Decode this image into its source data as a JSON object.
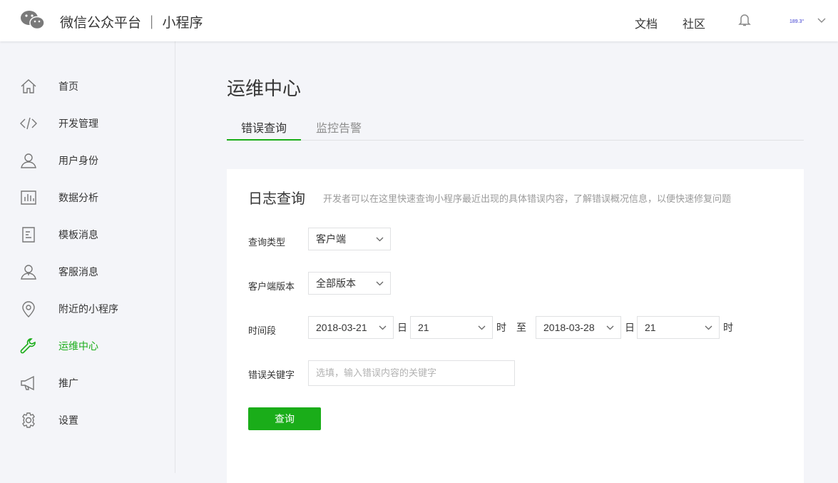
{
  "header": {
    "brand": "微信公众平台 ｜ 小程序",
    "links": [
      "文档",
      "社区"
    ],
    "user": "189.3°"
  },
  "sidebar": {
    "items": [
      {
        "label": "首页",
        "icon": "home-icon"
      },
      {
        "label": "开发管理",
        "icon": "code-icon"
      },
      {
        "label": "用户身份",
        "icon": "user-icon"
      },
      {
        "label": "数据分析",
        "icon": "chart-icon"
      },
      {
        "label": "模板消息",
        "icon": "document-icon"
      },
      {
        "label": "客服消息",
        "icon": "support-icon"
      },
      {
        "label": "附近的小程序",
        "icon": "location-icon"
      },
      {
        "label": "运维中心",
        "icon": "wrench-icon",
        "active": true
      },
      {
        "label": "推广",
        "icon": "megaphone-icon"
      },
      {
        "label": "设置",
        "icon": "gear-icon"
      }
    ]
  },
  "page": {
    "title": "运维中心",
    "tabs": [
      "错误查询",
      "监控告警"
    ]
  },
  "card": {
    "title": "日志查询",
    "desc": "开发者可以在这里快速查询小程序最近出现的具体错误内容，了解错误概况信息，以便快速修复问题",
    "query_type_label": "查询类型",
    "query_type": "客户端",
    "version_label": "客户端版本",
    "version": "全部版本",
    "time_label": "时间段",
    "start_date": "2018-03-21",
    "day_unit": "日",
    "start_hour": "21",
    "hour_unit": "时",
    "to": "至",
    "end_date": "2018-03-28",
    "end_hour": "21",
    "keyword_label": "错误关键字",
    "keyword_placeholder": "选填，输入错误内容的关键字",
    "submit": "查询"
  },
  "colors": {
    "accent": "#1aad19"
  }
}
